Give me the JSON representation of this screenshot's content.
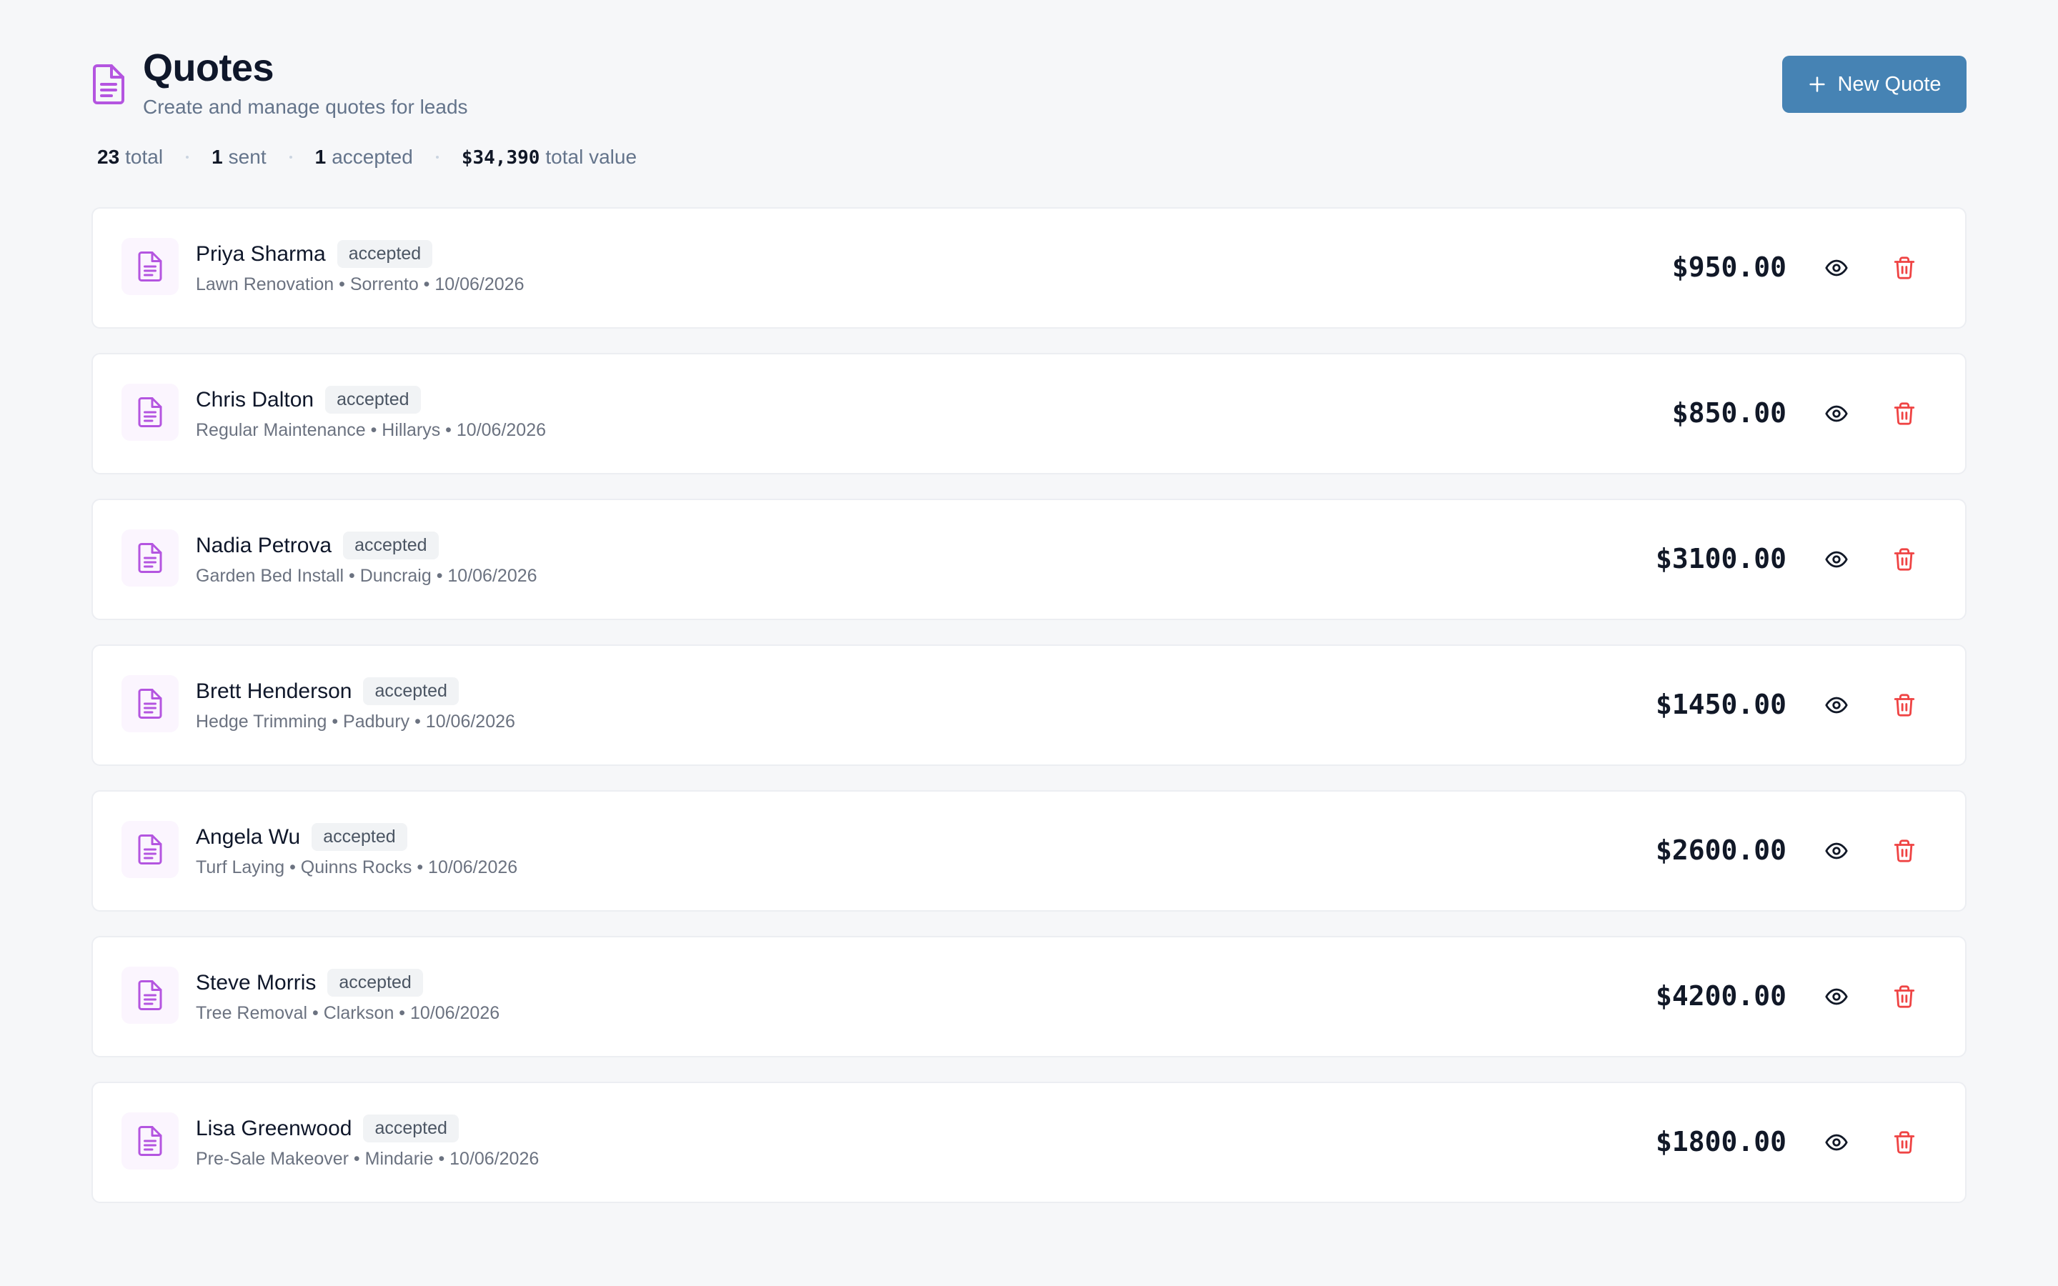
{
  "header": {
    "title": "Quotes",
    "subtitle": "Create and manage quotes for leads",
    "new_quote_label": "New Quote"
  },
  "stats": {
    "total_count": "23",
    "total_label": "total",
    "sent_count": "1",
    "sent_label": "sent",
    "accepted_count": "1",
    "accepted_label": "accepted",
    "total_value": "$34,390",
    "total_value_label": "total value"
  },
  "quotes": [
    {
      "client": "Priya Sharma",
      "status": "accepted",
      "details": "Lawn Renovation • Sorrento • 10/06/2026",
      "amount": "$950.00"
    },
    {
      "client": "Chris Dalton",
      "status": "accepted",
      "details": "Regular Maintenance • Hillarys • 10/06/2026",
      "amount": "$850.00"
    },
    {
      "client": "Nadia Petrova",
      "status": "accepted",
      "details": "Garden Bed Install • Duncraig • 10/06/2026",
      "amount": "$3100.00"
    },
    {
      "client": "Brett Henderson",
      "status": "accepted",
      "details": "Hedge Trimming • Padbury • 10/06/2026",
      "amount": "$1450.00"
    },
    {
      "client": "Angela Wu",
      "status": "accepted",
      "details": "Turf Laying • Quinns Rocks • 10/06/2026",
      "amount": "$2600.00"
    },
    {
      "client": "Steve Morris",
      "status": "accepted",
      "details": "Tree Removal • Clarkson • 10/06/2026",
      "amount": "$4200.00"
    },
    {
      "client": "Lisa Greenwood",
      "status": "accepted",
      "details": "Pre-Sale Makeover • Mindarie • 10/06/2026",
      "amount": "$1800.00"
    }
  ],
  "colors": {
    "accent": "#4683b4",
    "icon_purple": "#b455e0",
    "delete_red": "#ef4444",
    "background": "#f6f7f9"
  }
}
